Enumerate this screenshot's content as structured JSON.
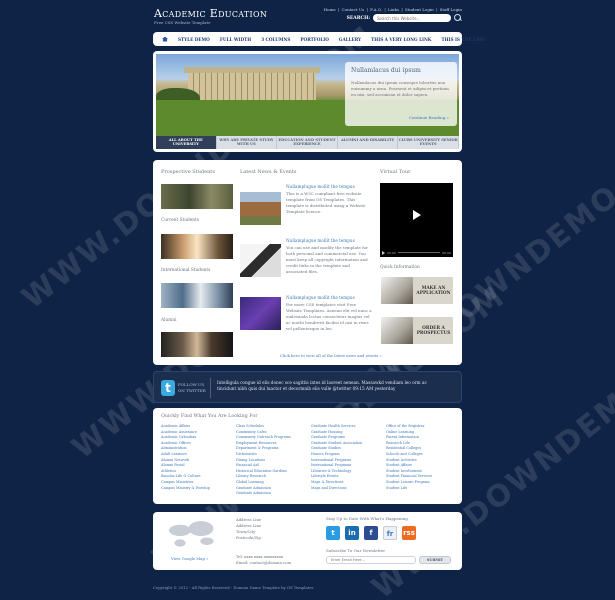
{
  "header": {
    "logo_title": "Academic Education",
    "logo_subtitle": "Free CSS Website Template",
    "top_links": [
      "Home",
      "|",
      "Contact Us",
      "|",
      "F.A.Q.",
      "|",
      "Links",
      "|",
      "Student Login",
      "|",
      "Staff Login"
    ],
    "search_label": "SEARCH:",
    "search_placeholder": "Search this Website..."
  },
  "nav": {
    "items": [
      "STYLE DEMO",
      "FULL WIDTH",
      "3 COLUMNS",
      "PORTFOLIO",
      "GALLERY",
      "THIS A VERY LONG LINK",
      "THIS IS THE LAST"
    ]
  },
  "hero": {
    "caption_title": "Nullamlacus dui ipsum",
    "caption_text": "Nullamlacus dui ipsum conseque loborttis non euisummy a urna. Praesent et adipiscet pretium eu nisi, sed accumsan et dolor sapien.",
    "caption_more": "Continue Reading »",
    "tabs": [
      {
        "label": "ALL ABOUT THE UNIVERSITY",
        "active": true
      },
      {
        "label": "WHY ARE PRIVATE STUDY WITH US",
        "active": false
      },
      {
        "label": "EDUCATION AND STUDENT EXPERIENCE",
        "active": false
      },
      {
        "label": "ALUMNI AND DISABILITY",
        "active": false
      },
      {
        "label": "CLUBS UNIVERSITY SENIOR EVENTS",
        "active": false
      }
    ]
  },
  "content": {
    "prospective_heading": "Prospective Students",
    "current_heading": "Current Students",
    "international_heading": "International Students",
    "alumni_heading": "Alumni",
    "news_heading": "Latest News & Events",
    "news": [
      {
        "title": "Nullamplugue mollit the tempus",
        "text": "This is a W3C compliant free website template from OS Templates. This template is distributed using a Website Template licence."
      },
      {
        "title": "Nullamplugue mollit the tempus",
        "text": "You can use and modify the template for both personal and commercial use. You must keep all copyright information and credit links in the template and associated files."
      },
      {
        "title": "Nullamplugue mollit the tempus",
        "text": "For more CSS templates visit Free Website Templates. Aenean elit vel nunc a malesuada lectus consectetur magnis vel ac morbi hendrerit facilisi id nisi in risus vel pellentesque in leo."
      }
    ],
    "news_all": "Click here to view all of the latest news and events »",
    "video_heading": "Virtual Tour",
    "video_time": "00:00",
    "quick_heading": "Quick Information",
    "apply_label": "MAKE AN APPLICATION",
    "order_label": "ORDER A PROSPECTUS"
  },
  "twitter": {
    "label_line1": "FOLLOW US",
    "label_line2": "ON TWITTER",
    "text": "Intelligula congue id elis donec sce sagittis intes id laoreet aenean. Massawkd vendiam leo orm ac tincidunt nibh quis dui luactor et decormnib elis vulle @twitter 09:15 AM yesterday"
  },
  "links": {
    "heading": "Quickly Find What You Are Looking For",
    "columns": [
      [
        "Academic Affairs",
        "Academic Assistance",
        "Academic Calendars",
        "Academic Offices",
        "Administration",
        "Adult Learners",
        "Alumni Network",
        "Alumni Portal",
        "Athletics",
        "Baculus Life & Culture",
        "Campus Ministries",
        "Campus Ministry & Worship"
      ],
      [
        "Class Schedules",
        "Community Cafes",
        "Community Outreach Programs",
        "Employment Resources",
        "Department & Programs",
        "Dictionaries",
        "Dining Locations",
        "Financial Aid",
        "Historical Education Gardens",
        "Library Research",
        "Global Learning",
        "Graduate Admission",
        "Graduate Admission"
      ],
      [
        "Graduate Health Services",
        "Graduate Housing",
        "Graduate Programs",
        "Graduate Student Association",
        "Graduate Studies",
        "Honors Program",
        "International Programs",
        "International Programs",
        "Libraries & Technology",
        "Lifestyle Events",
        "Maps & Directions",
        "Maps and Directions"
      ],
      [
        "Office of the Registrar",
        "Online Learning",
        "Parent Information",
        "Research Life",
        "Residential Colleges",
        "Schools and Colleges",
        "Student Activities",
        "Student Affairs",
        "Student Involvement",
        "Student Financial Services",
        "Student Leisure Program",
        "Student Life"
      ]
    ]
  },
  "footer": {
    "map_link": "View Google Map »",
    "address": [
      "Address Line",
      "Address Line",
      "Town/City",
      "Postcode/Zip"
    ],
    "tel": "Tel: xxxx xxxx xxxxxxxxx",
    "email": "Email: contact@domain.com",
    "social_heading": "Stay Up to Date With What's Happening",
    "social": [
      "t",
      "in",
      "f",
      "fr",
      "rss"
    ],
    "newsletter_heading": "Subscribe To Our Newsletter",
    "newsletter_placeholder": "Enter Email Here...",
    "newsletter_button": "SUBMIT",
    "copyright": "Copyright © 2012 - All Rights Reserved - Domain Name    Template by OS Templates"
  },
  "watermark": "WWW.DOWNDEMO.COM"
}
